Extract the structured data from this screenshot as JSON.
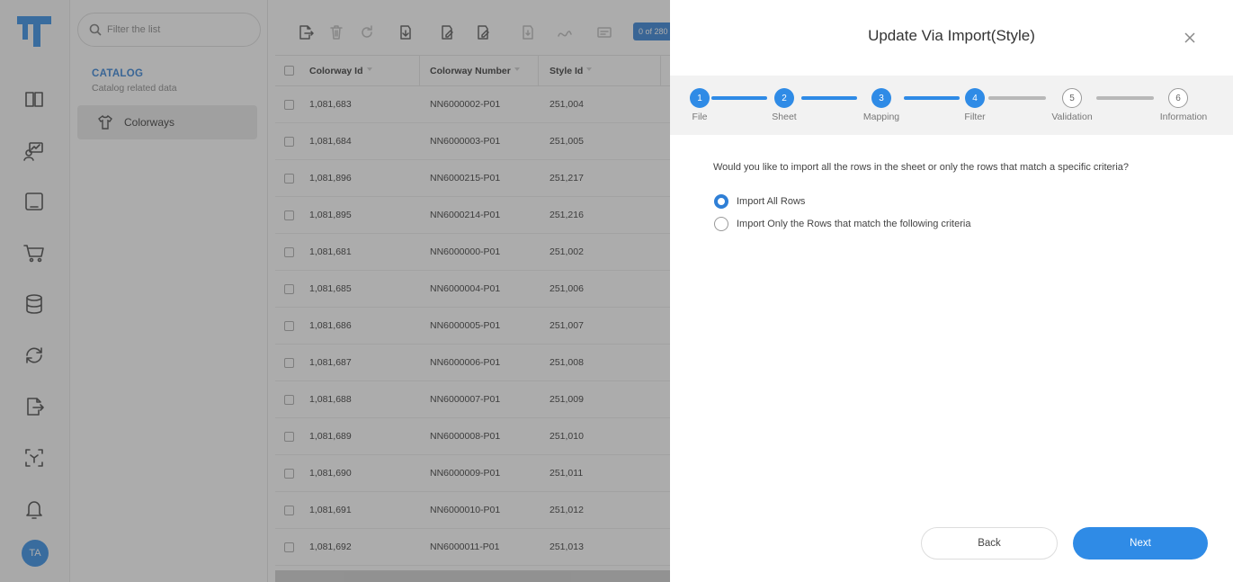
{
  "nav": {
    "filter_placeholder": "Filter the list",
    "catalog_title": "CATALOG",
    "catalog_subtitle": "Catalog related data",
    "active_item": "Colorways"
  },
  "rail": {
    "icons": [
      "book-icon",
      "chart-user-icon",
      "inbox-icon",
      "cart-icon",
      "database-icon",
      "sync-icon",
      "export-icon",
      "scan-icon",
      "bell-icon"
    ],
    "avatar_initials": "TA",
    "brand_color": "#2f8be6"
  },
  "toolbar": {
    "count_label": "0 of 280"
  },
  "grid": {
    "columns": [
      "Colorway Id",
      "Colorway Number",
      "Style Id"
    ],
    "rows": [
      [
        "1,081,683",
        "NN6000002-P01",
        "251,004"
      ],
      [
        "1,081,684",
        "NN6000003-P01",
        "251,005"
      ],
      [
        "1,081,896",
        "NN6000215-P01",
        "251,217"
      ],
      [
        "1,081,895",
        "NN6000214-P01",
        "251,216"
      ],
      [
        "1,081,681",
        "NN6000000-P01",
        "251,002"
      ],
      [
        "1,081,685",
        "NN6000004-P01",
        "251,006"
      ],
      [
        "1,081,686",
        "NN6000005-P01",
        "251,007"
      ],
      [
        "1,081,687",
        "NN6000006-P01",
        "251,008"
      ],
      [
        "1,081,688",
        "NN6000007-P01",
        "251,009"
      ],
      [
        "1,081,689",
        "NN6000008-P01",
        "251,010"
      ],
      [
        "1,081,690",
        "NN6000009-P01",
        "251,011"
      ],
      [
        "1,081,691",
        "NN6000010-P01",
        "251,012"
      ],
      [
        "1,081,692",
        "NN6000011-P01",
        "251,013"
      ]
    ]
  },
  "modal": {
    "title": "Update Via Import(Style)",
    "steps": [
      {
        "num": "1",
        "label": "File",
        "state": "active"
      },
      {
        "num": "2",
        "label": "Sheet",
        "state": "active"
      },
      {
        "num": "3",
        "label": "Mapping",
        "state": "active"
      },
      {
        "num": "4",
        "label": "Filter",
        "state": "active"
      },
      {
        "num": "5",
        "label": "Validation",
        "state": "pending"
      },
      {
        "num": "6",
        "label": "Information",
        "state": "pending"
      }
    ],
    "question": "Would you like to import all the rows in the sheet or only the rows that match a specific criteria?",
    "option_all": "Import All Rows",
    "option_criteria": "Import Only the Rows that match the following criteria",
    "selected_option": "Import All Rows",
    "back_label": "Back",
    "next_label": "Next"
  }
}
